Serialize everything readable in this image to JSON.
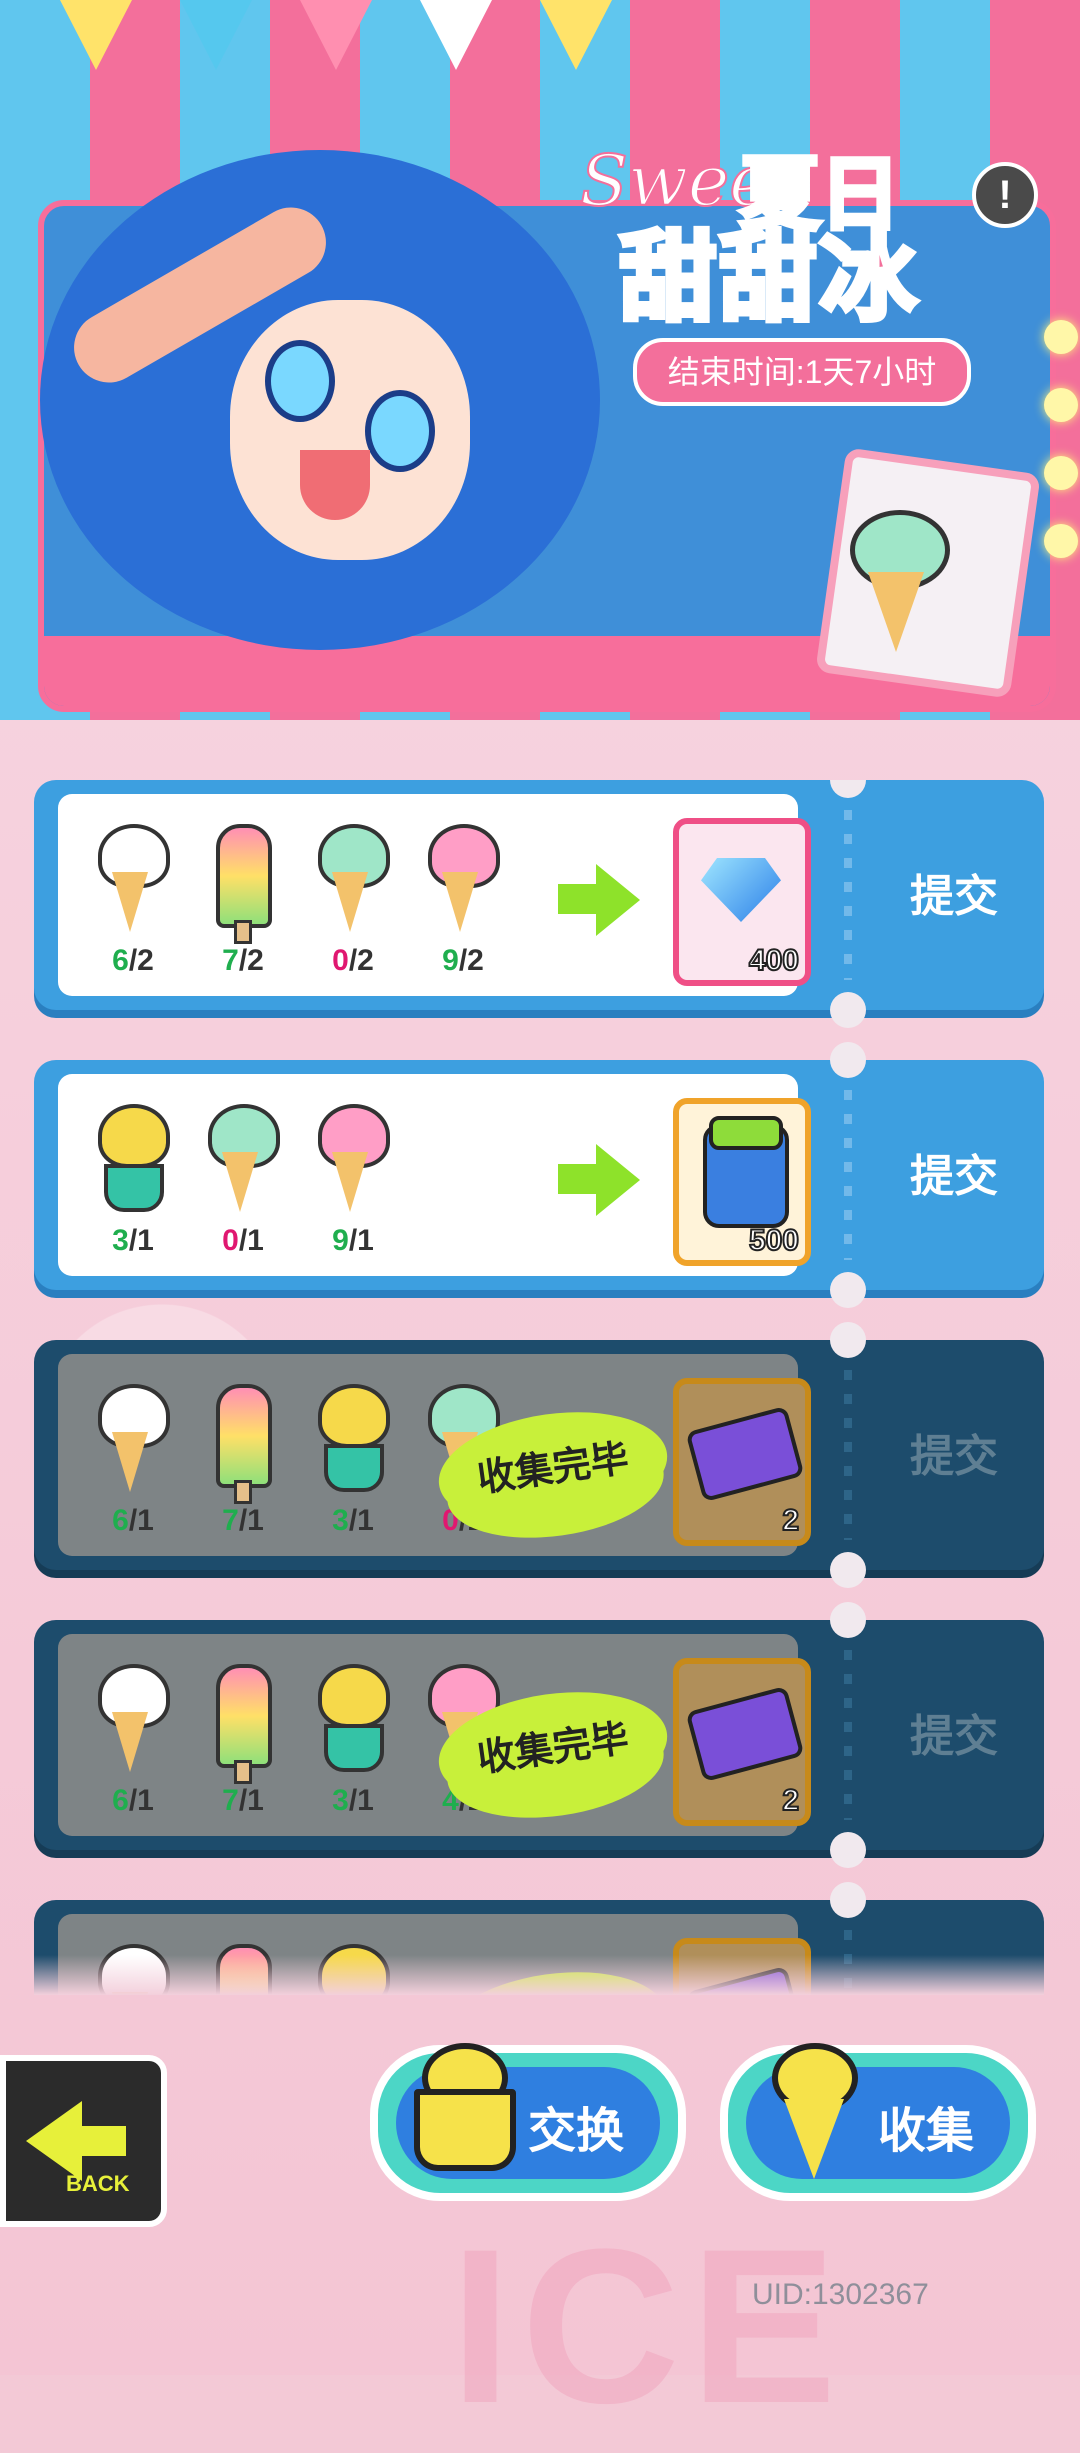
{
  "event": {
    "title_script": "Sweet",
    "title_top": "夏日",
    "title_main": "甜甜冰",
    "timer": "结束时间:1天7小时",
    "info_icon": "!"
  },
  "quests": [
    {
      "state": "active",
      "items": [
        {
          "icon": "vanilla-cone-icon",
          "have": "6",
          "need": "/2",
          "color": "#1fae4e"
        },
        {
          "icon": "rainbow-popsicle-icon",
          "have": "7",
          "need": "/2",
          "color": "#1fae4e"
        },
        {
          "icon": "mint-cone-icon",
          "have": "0",
          "need": "/2",
          "color": "#e01770"
        },
        {
          "icon": "strawberry-cone-icon",
          "have": "9",
          "need": "/2",
          "color": "#1fae4e"
        }
      ],
      "reward": {
        "icon": "diamond-icon",
        "amount": "400",
        "frame": "pink"
      },
      "submit": "提交"
    },
    {
      "state": "active",
      "items": [
        {
          "icon": "sundae-cup-icon",
          "have": "3",
          "need": "/1",
          "color": "#1fae4e"
        },
        {
          "icon": "mint-cone-icon",
          "have": "0",
          "need": "/1",
          "color": "#e01770"
        },
        {
          "icon": "strawberry-cone-icon",
          "have": "9",
          "need": "/1",
          "color": "#1fae4e"
        }
      ],
      "reward": {
        "icon": "coin-jar-icon",
        "amount": "500",
        "frame": "orange"
      },
      "submit": "提交"
    },
    {
      "state": "done",
      "items": [
        {
          "icon": "vanilla-cone-icon",
          "have": "6",
          "need": "/1",
          "color": "#1fae4e"
        },
        {
          "icon": "rainbow-popsicle-icon",
          "have": "7",
          "need": "/1",
          "color": "#1fae4e"
        },
        {
          "icon": "sundae-cup-icon",
          "have": "3",
          "need": "/1",
          "color": "#1fae4e"
        },
        {
          "icon": "mint-cone-icon",
          "have": "0",
          "need": "/1",
          "color": "#e01770"
        }
      ],
      "reward": {
        "icon": "ticket-icon",
        "amount": "2",
        "frame": "gold"
      },
      "stamp": "收集完毕",
      "submit": "提交"
    },
    {
      "state": "done",
      "items": [
        {
          "icon": "vanilla-cone-icon",
          "have": "6",
          "need": "/1",
          "color": "#1fae4e"
        },
        {
          "icon": "rainbow-popsicle-icon",
          "have": "7",
          "need": "/1",
          "color": "#1fae4e"
        },
        {
          "icon": "sundae-cup-icon",
          "have": "3",
          "need": "/1",
          "color": "#1fae4e"
        },
        {
          "icon": "strawberry-cone-icon",
          "have": "4",
          "need": "/1",
          "color": "#1fae4e"
        }
      ],
      "reward": {
        "icon": "ticket-icon",
        "amount": "2",
        "frame": "gold"
      },
      "stamp": "收集完毕",
      "submit": "提交"
    },
    {
      "state": "done",
      "items": [
        {
          "icon": "vanilla-cone-icon",
          "have": "",
          "need": "",
          "color": "#1fae4e"
        },
        {
          "icon": "rainbow-popsicle-icon",
          "have": "",
          "need": "",
          "color": "#1fae4e"
        },
        {
          "icon": "sundae-cup-icon",
          "have": "",
          "need": "",
          "color": "#1fae4e"
        }
      ],
      "reward": {
        "icon": "ticket-icon",
        "amount": "",
        "frame": "gold"
      },
      "stamp": "",
      "submit": ""
    }
  ],
  "nav": {
    "back_label": "BACK",
    "exchange_label": "交换",
    "collect_label": "收集"
  },
  "uid": "UID:1302367",
  "colors": {
    "accent_blue": "#3d9fe0",
    "accent_pink": "#f36f9b",
    "done_navy": "#1d4c6c",
    "lime": "#c8f03a"
  }
}
